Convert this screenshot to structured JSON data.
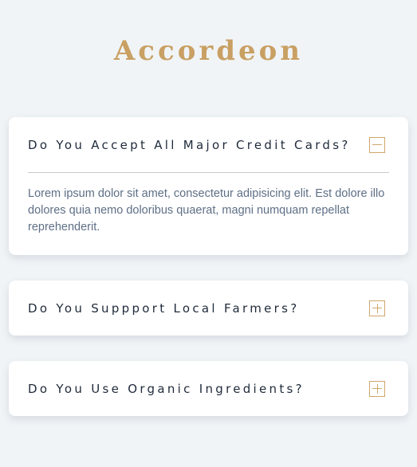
{
  "page": {
    "title": "Accordeon"
  },
  "accordion": {
    "items": [
      {
        "question": "Do You Accept All Major Credit Cards?",
        "expanded": true,
        "toggle_icon": "minus-icon",
        "answer": "Lorem ipsum dolor sit amet, consectetur adipisicing elit. Est dolore illo dolores quia nemo doloribus quaerat, magni numquam repellat reprehenderit."
      },
      {
        "question": "Do You Suppport Local Farmers?",
        "expanded": false,
        "toggle_icon": "plus-icon"
      },
      {
        "question": "Do You Use Organic Ingredients?",
        "expanded": false,
        "toggle_icon": "plus-icon"
      }
    ]
  },
  "colors": {
    "background": "#f0f4f7",
    "accent": "#c9a063",
    "question_text": "#1f2a3a",
    "answer_text": "#5e6f86"
  }
}
